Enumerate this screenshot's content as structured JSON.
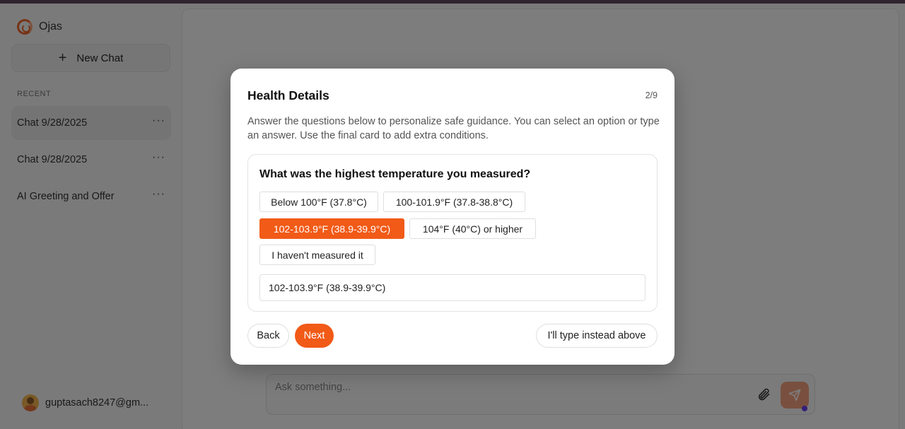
{
  "app": {
    "name": "Ojas"
  },
  "sidebar": {
    "new_chat_label": "New Chat",
    "recent_label": "RECENT",
    "items": [
      {
        "label": "Chat 9/28/2025",
        "active": true
      },
      {
        "label": "Chat 9/28/2025",
        "active": false
      },
      {
        "label": "AI Greeting and Offer",
        "active": false
      }
    ],
    "more_label": "···",
    "user_label": "guptasach8247@gm..."
  },
  "composer": {
    "placeholder": "Ask something..."
  },
  "modal": {
    "title": "Health Details",
    "step": "2/9",
    "description": "Answer the questions below to personalize safe guidance. You can select an option or type an answer. Use the final card to add extra conditions.",
    "question": "What was the highest temperature you measured?",
    "options": [
      "Below 100°F (37.8°C)",
      "100-101.9°F (37.8-38.8°C)",
      "102-103.9°F (38.9-39.9°C)",
      "104°F (40°C) or higher",
      "I haven't measured it"
    ],
    "selected_option": "102-103.9°F (38.9-39.9°C)",
    "answer_value": "102-103.9°F (38.9-39.9°C)",
    "back_label": "Back",
    "next_label": "Next",
    "type_instead_label": "I'll type instead above"
  },
  "colors": {
    "accent": "#f15a17",
    "send_button": "#f3a17f",
    "overlay": "rgba(0,0,0,0.5)"
  }
}
